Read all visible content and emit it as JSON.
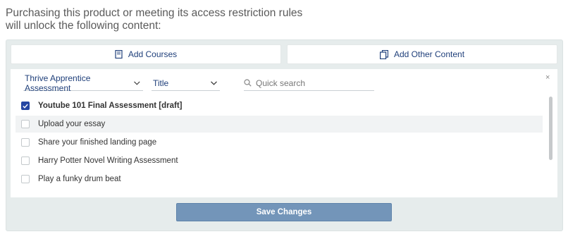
{
  "intro": {
    "line1": "Purchasing this product or meeting its access restriction rules",
    "line2": "will unlock the following content:"
  },
  "tabs": {
    "courses_label": "Add Courses",
    "other_label": "Add Other Content"
  },
  "filters": {
    "type_selected": "Thrive Apprentice Assessment",
    "sort_selected": "Title",
    "search_placeholder": "Quick search"
  },
  "items": [
    {
      "label": "Youtube 101 Final Assessment [draft]",
      "checked": true
    },
    {
      "label": "Upload your essay",
      "checked": false
    },
    {
      "label": "Share your finished landing page",
      "checked": false
    },
    {
      "label": "Harry Potter Novel Writing Assessment",
      "checked": false
    },
    {
      "label": "Play a funky drum beat",
      "checked": false
    }
  ],
  "actions": {
    "close_glyph": "×",
    "save_label": "Save Changes"
  },
  "colors": {
    "accent": "#1f3f7a",
    "checkbox_checked": "#2446a3",
    "save_button": "#7395b9",
    "panel_bg": "#e6ecec"
  }
}
